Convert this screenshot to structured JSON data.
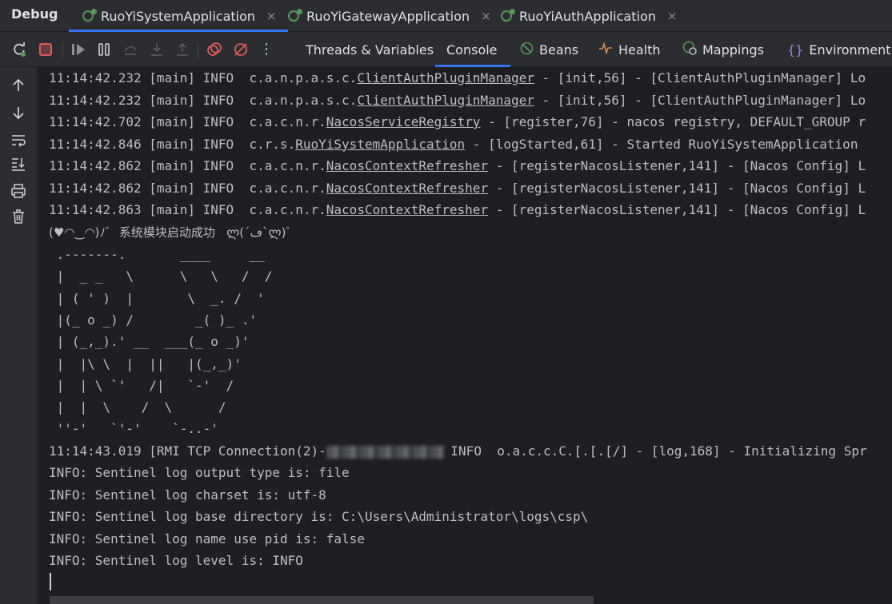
{
  "panel_title": "Debug",
  "run_tabs": [
    {
      "label": "RuoYiSystemApplication",
      "close": "×"
    },
    {
      "label": "RuoYiGatewayApplication",
      "close": "×"
    },
    {
      "label": "RuoYiAuthApplication",
      "close": "×"
    }
  ],
  "toolbar": {
    "icons": [
      "rerun-icon",
      "stop-icon",
      "resume-icon",
      "pause-icon",
      "step-over-icon",
      "step-into-icon",
      "step-out-icon",
      "view-breakpoints-icon",
      "mute-breakpoints-icon",
      "more-icon"
    ],
    "more_glyph": "⋮"
  },
  "view_tabs": [
    {
      "label": "Threads & Variables",
      "icon": ""
    },
    {
      "label": "Console",
      "icon": ""
    },
    {
      "label": "Beans",
      "icon": "beans-icon"
    },
    {
      "label": "Health",
      "icon": "health-icon"
    },
    {
      "label": "Mappings",
      "icon": "mappings-icon"
    },
    {
      "label": "Environment",
      "icon": "environment-icon"
    }
  ],
  "gutter_icons": [
    "up-arrow-icon",
    "down-arrow-icon",
    "soft-wrap-icon",
    "scroll-to-end-icon",
    "print-icon",
    "trash-icon"
  ],
  "console": {
    "log_lines": [
      {
        "prefix": "11:14:42.232 [main] INFO  c.a.n.p.a.s.c.",
        "cls": "ClientAuthPluginManager",
        "suffix": " - [init,56] - [ClientAuthPluginManager] Lo"
      },
      {
        "prefix": "11:14:42.232 [main] INFO  c.a.n.p.a.s.c.",
        "cls": "ClientAuthPluginManager",
        "suffix": " - [init,56] - [ClientAuthPluginManager] Lo"
      },
      {
        "prefix": "11:14:42.702 [main] INFO  c.a.c.n.r.",
        "cls": "NacosServiceRegistry",
        "suffix": " - [register,76] - nacos registry, DEFAULT_GROUP r"
      },
      {
        "prefix": "11:14:42.846 [main] INFO  c.r.s.",
        "cls": "RuoYiSystemApplication",
        "suffix": " - [logStarted,61] - Started RuoYiSystemApplication"
      },
      {
        "prefix": "11:14:42.862 [main] INFO  c.a.c.n.r.",
        "cls": "NacosContextRefresher",
        "suffix": " - [registerNacosListener,141] - [Nacos Config] L"
      },
      {
        "prefix": "11:14:42.862 [main] INFO  c.a.c.n.r.",
        "cls": "NacosContextRefresher",
        "suffix": " - [registerNacosListener,141] - [Nacos Config] L"
      },
      {
        "prefix": "11:14:42.863 [main] INFO  c.a.c.n.r.",
        "cls": "NacosContextRefresher",
        "suffix": " - [registerNacosListener,141] - [Nacos Config] L"
      }
    ],
    "banner_title": "(♥◠‿◠)ﾉﾞ  系统模块启动成功   ლ(´ڡ`ლ)ﾞ",
    "ascii_art": [
      " .-------.       ____     __",
      " |  _ _   \\      \\   \\   /  /",
      " | ( ' )  |       \\  _. /  '",
      " |(_ o _) /        _( )_ .'",
      " | (_,_).' __  ___(_ o _)'",
      " |  |\\ \\  |  ||   |(_,_)'",
      " |  | \\ `'   /|   `-'  /",
      " |  |  \\    /  \\      /",
      " ''-'   `'-'    `-..-'"
    ],
    "rmi_line": {
      "prefix": "11:14:43.019 [RMI TCP Connection(2)-",
      "suffix": " INFO  o.a.c.c.C.[.[.[/] - [log,168] - Initializing Spr"
    },
    "sentinel_lines": [
      "INFO: Sentinel log output type is: file",
      "INFO: Sentinel log charset is: utf-8",
      "INFO: Sentinel log base directory is: C:\\Users\\Administrator\\logs\\csp\\",
      "INFO: Sentinel log name use pid is: false",
      "INFO: Sentinel log level is: INFO"
    ]
  },
  "colors": {
    "accent": "#3574f0",
    "run_green": "#57965c",
    "stop_red": "#db5c5c",
    "background": "#1e1f22",
    "panel": "#2b2d30"
  }
}
